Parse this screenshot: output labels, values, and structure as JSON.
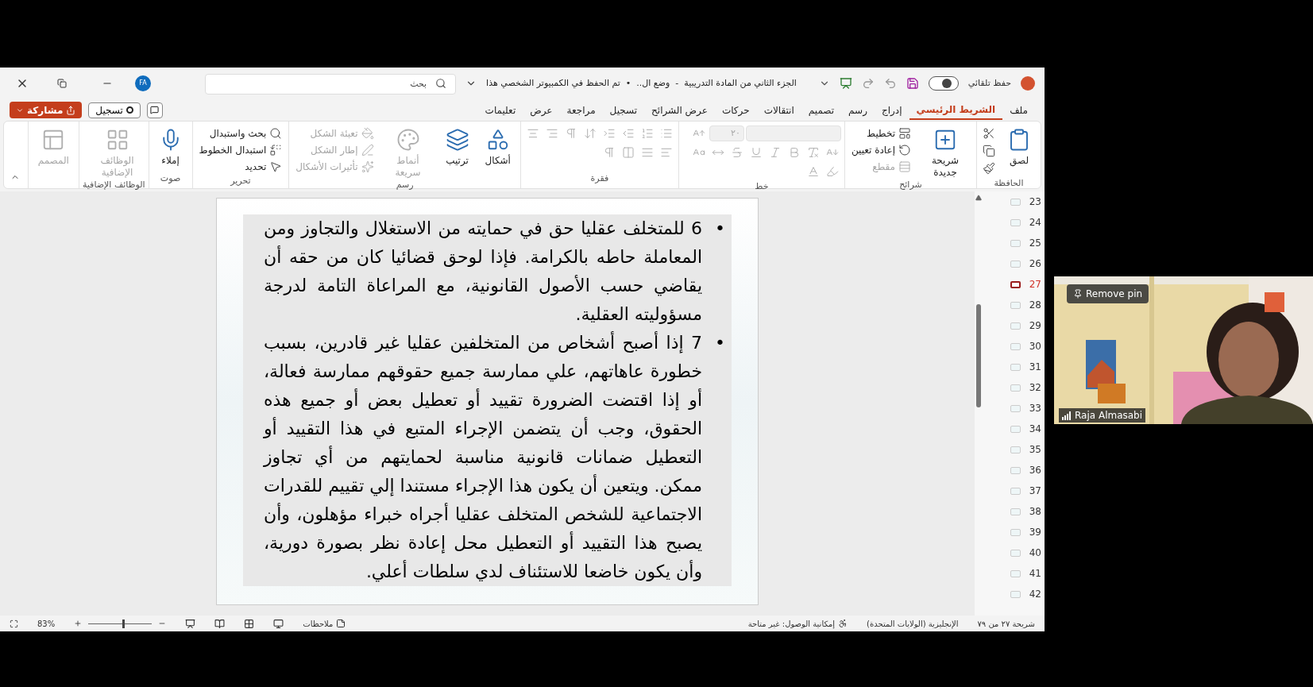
{
  "title_bar": {
    "title": "الجزء الثاني من المادة التدريبية  -  وضع ال..  •  تم الحفظ في الكمبيوتر الشخصي هذا",
    "autosave_label": "حفظ تلقائي",
    "autosave_on": false,
    "search": {
      "placeholder": "بحث"
    },
    "avatar": "FA"
  },
  "tabs": [
    {
      "label": "ملف",
      "selected": false
    },
    {
      "label": "الشريط الرئيسي",
      "selected": true
    },
    {
      "label": "إدراج",
      "selected": false
    },
    {
      "label": "رسم",
      "selected": false
    },
    {
      "label": "تصميم",
      "selected": false
    },
    {
      "label": "انتقالات",
      "selected": false
    },
    {
      "label": "حركات",
      "selected": false
    },
    {
      "label": "عرض الشرائح",
      "selected": false
    },
    {
      "label": "تسجيل",
      "selected": false
    },
    {
      "label": "مراجعة",
      "selected": false
    },
    {
      "label": "عرض",
      "selected": false
    },
    {
      "label": "تعليمات",
      "selected": false
    }
  ],
  "actions": {
    "record": "تسجيل",
    "share": "مشاركة"
  },
  "ribbon": [
    {
      "label": "الحافظة",
      "items": [
        {
          "kind": "large",
          "label": "لصق",
          "disabled": false
        },
        {
          "kind": "icon",
          "disabled": false
        },
        {
          "kind": "icon",
          "disabled": false
        },
        {
          "kind": "icon",
          "disabled": false
        }
      ]
    },
    {
      "label": "شرائح",
      "items": [
        {
          "kind": "large",
          "label": "شريحة جديدة",
          "disabled": false
        },
        {
          "kind": "small",
          "label": "تخطيط",
          "disabled": false
        },
        {
          "kind": "small",
          "label": "إعادة تعيين",
          "disabled": false
        },
        {
          "kind": "small",
          "label": "مقطع",
          "disabled": true
        }
      ]
    },
    {
      "label": "خط",
      "items": [
        {
          "kind": "field",
          "disabled": true
        },
        {
          "kind": "field",
          "value": "٢٠",
          "disabled": true
        },
        {
          "kind": "icon",
          "disabled": true
        },
        {
          "kind": "icon",
          "disabled": true
        },
        {
          "kind": "icon",
          "disabled": true
        },
        {
          "kind": "icon",
          "disabled": true
        },
        {
          "kind": "icon",
          "disabled": true
        },
        {
          "kind": "icon",
          "disabled": true
        },
        {
          "kind": "icon",
          "disabled": true
        },
        {
          "kind": "icon",
          "disabled": true
        },
        {
          "kind": "icon",
          "disabled": true
        },
        {
          "kind": "icon",
          "disabled": true
        },
        {
          "kind": "icon",
          "disabled": true
        }
      ]
    },
    {
      "label": "فقرة",
      "items": [
        {
          "kind": "icon",
          "disabled": true
        },
        {
          "kind": "icon",
          "disabled": true
        },
        {
          "kind": "icon",
          "disabled": true
        },
        {
          "kind": "icon",
          "disabled": true
        },
        {
          "kind": "icon",
          "disabled": true
        },
        {
          "kind": "icon",
          "disabled": true
        },
        {
          "kind": "icon",
          "disabled": true
        },
        {
          "kind": "icon",
          "disabled": true
        },
        {
          "kind": "icon",
          "disabled": true
        },
        {
          "kind": "icon",
          "disabled": true
        },
        {
          "kind": "icon",
          "disabled": true
        },
        {
          "kind": "icon",
          "disabled": true
        }
      ]
    },
    {
      "label": "رسم",
      "items": [
        {
          "kind": "large",
          "label": "أشكال",
          "disabled": false
        },
        {
          "kind": "large",
          "label": "ترتيب",
          "disabled": false
        },
        {
          "kind": "large",
          "label": "أنماط سريعة",
          "disabled": true
        },
        {
          "kind": "small",
          "label": "تعبئة الشكل",
          "disabled": true
        },
        {
          "kind": "small",
          "label": "إطار الشكل",
          "disabled": true
        },
        {
          "kind": "small",
          "label": "تأثيرات الأشكال",
          "disabled": true
        }
      ]
    },
    {
      "label": "تحرير",
      "items": [
        {
          "kind": "small",
          "label": "بحث واستبدال",
          "disabled": false
        },
        {
          "kind": "small",
          "label": "استبدال الخطوط",
          "disabled": false
        },
        {
          "kind": "small",
          "label": "تحديد",
          "disabled": false
        }
      ]
    },
    {
      "label": "صوت",
      "items": [
        {
          "kind": "large",
          "label": "إملاء",
          "disabled": false
        }
      ]
    },
    {
      "label": "الوظائف الإضافية",
      "items": [
        {
          "kind": "large",
          "label": "الوظائف الإضافية",
          "disabled": true
        }
      ]
    },
    {
      "items": [
        {
          "kind": "large",
          "label": "المصمم",
          "disabled": true
        }
      ]
    }
  ],
  "slide": {
    "bullets": [
      {
        "bullet": "•",
        "text": "6 للمتخلف عقليا حق في حمايته من الاستغلال والتجاوز ومن المعاملة حاطه بالكرامة. فإذا لوحق قضائيا كان من حقه أن يقاضي حسب الأصول القانونية، مع المراعاة التامة لدرجة مسؤوليته العقلية."
      },
      {
        "bullet": "•",
        "text": "7 إذا أصبح أشخاص من المتخلفين عقليا غير قادرين، بسبب خطورة عاهاتهم، علي ممارسة جميع حقوقهم ممارسة فعالة، أو إذا اقتضت الضرورة تقييد أو تعطيل بعض أو جميع هذه الحقوق، وجب أن يتضمن الإجراء المتبع في هذا التقييد أو التعطيل ضمانات قانونية مناسبة لحمايتهم من أي تجاوز ممكن. ويتعين أن يكون هذا الإجراء مستندا إلي تقييم للقدرات الاجتماعية للشخص المتخلف عقليا أجراه خبراء مؤهلون، وأن يصبح هذا التقييد أو التعطيل محل إعادة نظر بصورة دورية، وأن يكون خاضعا للاستئناف لدي سلطات أعلي."
      }
    ]
  },
  "thumbnails": [
    {
      "number": "23",
      "selected": false
    },
    {
      "number": "24",
      "selected": false
    },
    {
      "number": "25",
      "selected": false
    },
    {
      "number": "26",
      "selected": false
    },
    {
      "number": "27",
      "selected": true
    },
    {
      "number": "28",
      "selected": false
    },
    {
      "number": "29",
      "selected": false
    },
    {
      "number": "30",
      "selected": false
    },
    {
      "number": "31",
      "selected": false
    },
    {
      "number": "32",
      "selected": false
    },
    {
      "number": "33",
      "selected": false
    },
    {
      "number": "34",
      "selected": false
    },
    {
      "number": "35",
      "selected": false
    },
    {
      "number": "36",
      "selected": false
    },
    {
      "number": "37",
      "selected": false
    },
    {
      "number": "38",
      "selected": false
    },
    {
      "number": "39",
      "selected": false
    },
    {
      "number": "40",
      "selected": false
    },
    {
      "number": "41",
      "selected": false
    },
    {
      "number": "42",
      "selected": false
    }
  ],
  "status_bar": {
    "slide_count": "شريحة ٢٧ من ٧٩",
    "language": "الإنجليزية (الولايات المتحدة)",
    "accessibility": "إمكانية الوصول: غير متاحة",
    "notes": "ملاحظات",
    "zoom": "83%",
    "zoom_slider": {
      "level": 0.55
    }
  },
  "video": {
    "pin_label": "Remove pin",
    "name": "Raja Almasabi"
  }
}
